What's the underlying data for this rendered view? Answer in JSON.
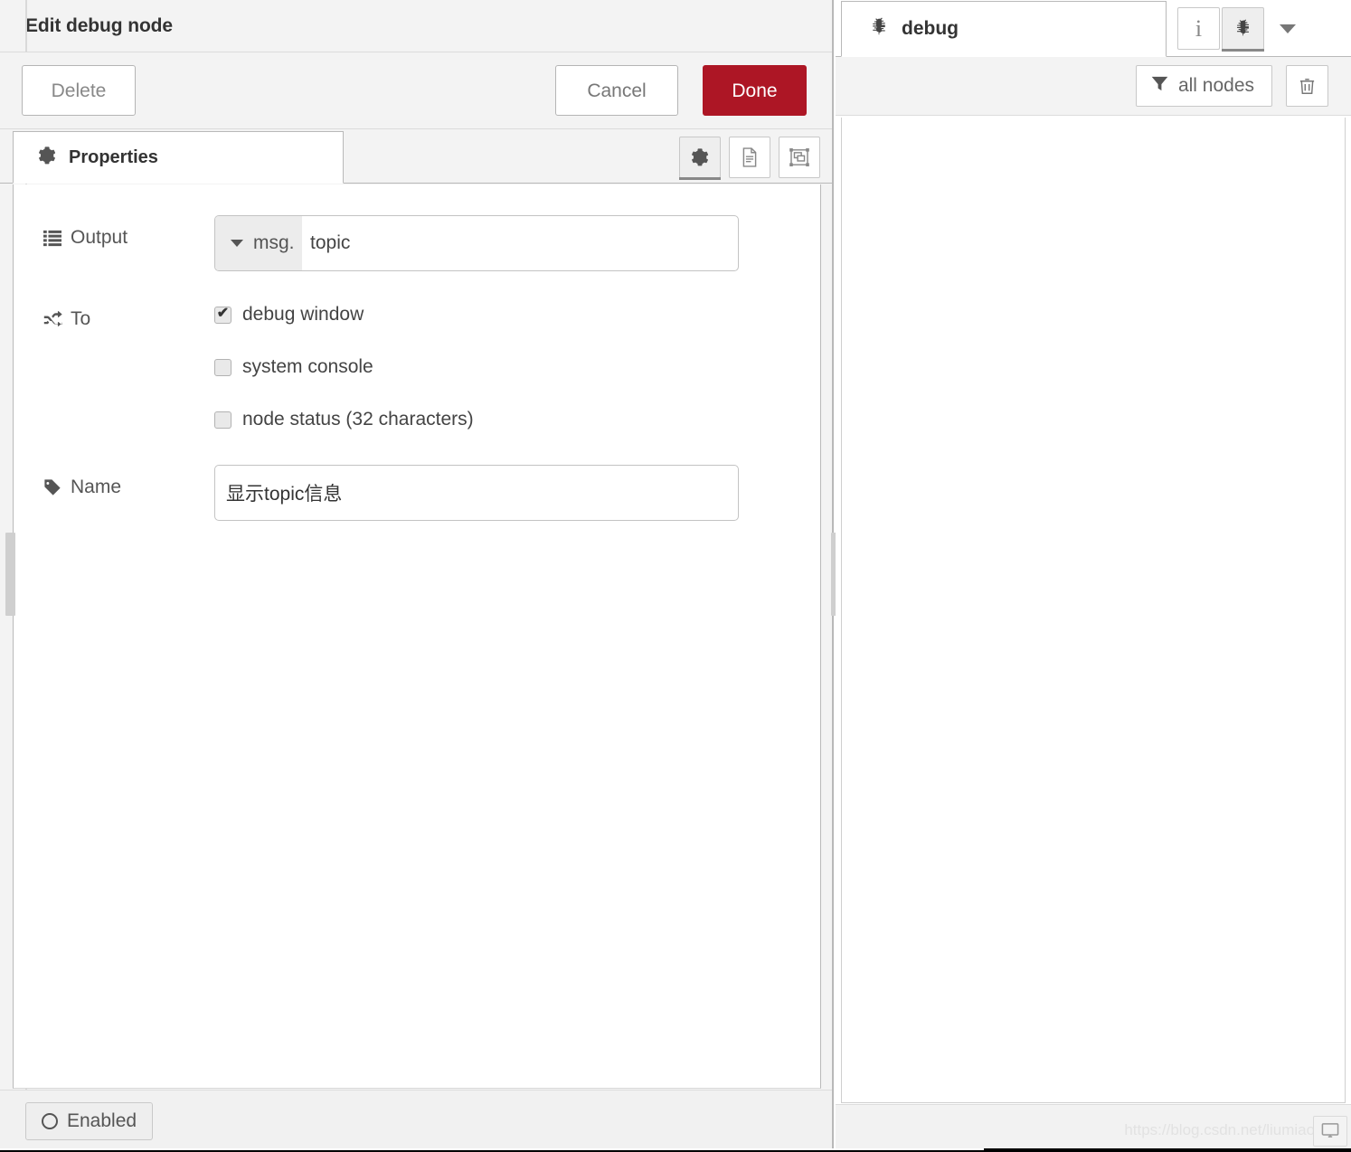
{
  "dialog": {
    "title": "Edit debug node",
    "delete_label": "Delete",
    "cancel_label": "Cancel",
    "done_label": "Done",
    "tabs": [
      {
        "label": "Properties",
        "icon": "gear-icon",
        "active": true
      }
    ],
    "panel_buttons": [
      {
        "name": "properties-panel-button",
        "icon": "gear-icon",
        "active": true
      },
      {
        "name": "description-panel-button",
        "icon": "file-lines-icon",
        "active": false
      },
      {
        "name": "appearance-panel-button",
        "icon": "object-group-icon",
        "active": false
      }
    ],
    "form": {
      "output": {
        "label": "Output",
        "icon": "list-icon",
        "prefix": "msg.",
        "value": "topic",
        "placeholder": ""
      },
      "to": {
        "label": "To",
        "icon": "shuffle-icon",
        "options": [
          {
            "label": "debug window",
            "checked": true
          },
          {
            "label": "system console",
            "checked": false
          },
          {
            "label": "node status (32 characters)",
            "checked": false
          }
        ]
      },
      "name": {
        "label": "Name",
        "icon": "tag-icon",
        "value": "显示topic信息",
        "placeholder": "Name"
      }
    },
    "footer": {
      "enabled_label": "Enabled",
      "enabled_icon": "circle-icon"
    }
  },
  "sidebar": {
    "tab": {
      "label": "debug",
      "icon": "bug-icon"
    },
    "header_buttons": [
      {
        "name": "info-tab-button",
        "icon": "info-icon",
        "label": "i",
        "active": false
      },
      {
        "name": "debug-tab-button",
        "icon": "bug-icon",
        "label": "",
        "active": true
      }
    ],
    "menu_caret": "caret-down-icon",
    "toolbar": {
      "filter_label": "all nodes",
      "filter_icon": "filter-icon",
      "clear_icon": "trash-icon"
    },
    "messages": [],
    "footer": {
      "watermark": "https://blog.csdn.net/liumiaocn",
      "screen_button_icon": "monitor-icon"
    }
  },
  "colors": {
    "accent_done": "#ad1625",
    "panel_bg": "#f3f3f3",
    "body_bg": "#ffffff",
    "border": "#b9b9b9",
    "text": "#333333",
    "muted_text": "#777777"
  }
}
